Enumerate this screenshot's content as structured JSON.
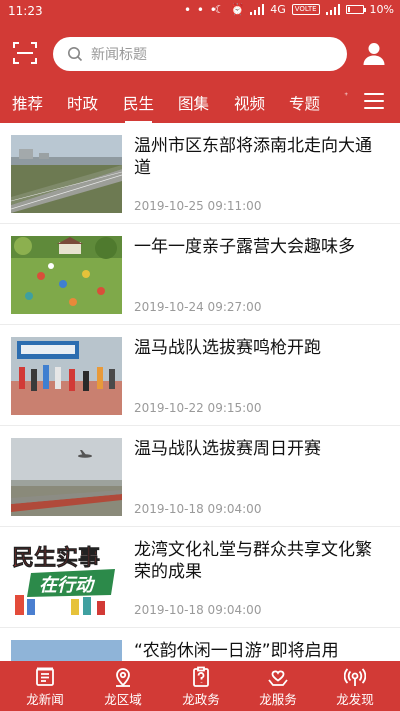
{
  "status_bar": {
    "time": "11:23",
    "dots": "• • •",
    "network": "4G",
    "volte": "VOLTE",
    "battery": "10%"
  },
  "search": {
    "placeholder": "新闻标题"
  },
  "tabs": [
    {
      "label": "推荐",
      "active": false
    },
    {
      "label": "时政",
      "active": false
    },
    {
      "label": "民生",
      "active": true
    },
    {
      "label": "图集",
      "active": false
    },
    {
      "label": "视频",
      "active": false
    },
    {
      "label": "专题",
      "active": false
    }
  ],
  "tab_overflow_hint": "ᐩ",
  "news": [
    {
      "title": "温州市区东部将添南北走向大通道",
      "date": "2019-10-25 09:11:00",
      "thumb": "highway-photo"
    },
    {
      "title": "一年一度亲子露营大会趣味多",
      "date": "2019-10-24 09:27:00",
      "thumb": "camping-photo"
    },
    {
      "title": "温马战队选拔赛鸣枪开跑",
      "date": "2019-10-22 09:15:00",
      "thumb": "marathon-start-photo"
    },
    {
      "title": "温马战队选拔赛周日开赛",
      "date": "2019-10-18 09:04:00",
      "thumb": "runway-plane-photo"
    },
    {
      "title": "龙湾文化礼堂与群众共享文化繁荣的成果",
      "date": "2019-10-18 09:04:00",
      "thumb": "minsheng-shishi-poster",
      "poster_line1": "民生实事",
      "poster_line2": "在行动"
    },
    {
      "title": "“农韵休闲一日游”即将启用",
      "date": "",
      "thumb": "countryside-photo"
    }
  ],
  "bottom_nav": [
    {
      "label": "龙新闻",
      "icon": "news-icon"
    },
    {
      "label": "龙区域",
      "icon": "location-icon"
    },
    {
      "label": "龙政务",
      "icon": "clipboard-icon"
    },
    {
      "label": "龙服务",
      "icon": "service-icon"
    },
    {
      "label": "龙发现",
      "icon": "broadcast-icon"
    }
  ],
  "colors": {
    "brand_red": "#d23a36",
    "date_gray": "#9a9a9a"
  }
}
